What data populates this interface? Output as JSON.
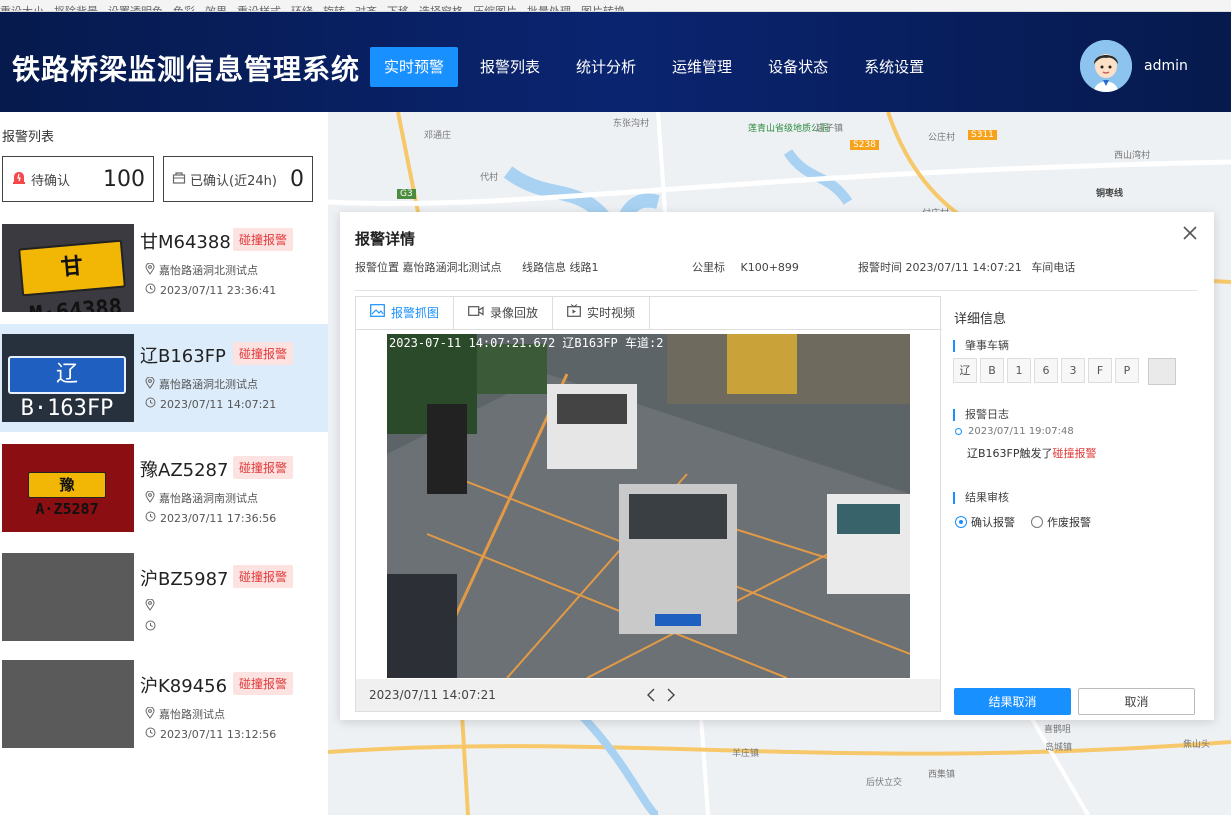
{
  "toolbar": [
    "重设大小",
    "抠除背景",
    "设置透明色",
    "色彩",
    "效果",
    "重设样式",
    "环绕",
    "旋转",
    "对齐",
    "下移",
    "选择窗格",
    "压缩图片",
    "批量处理",
    "图片转换"
  ],
  "header": {
    "title": "铁路桥梁监测信息管理系统",
    "nav": [
      "实时预警",
      "报警列表",
      "统计分析",
      "运维管理",
      "设备状态",
      "系统设置"
    ],
    "active_nav": "实时预警",
    "user": "admin"
  },
  "left_panel": {
    "title": "报警列表",
    "pending_label": "待确认",
    "pending_count": "100",
    "confirmed_label": "已确认(近24h)",
    "confirmed_count": "0",
    "alarms": [
      {
        "plate": "甘M64388",
        "tag": "碰撞报警",
        "location": "嘉怡路涵洞北测试点",
        "time": "2023/07/11 23:36:41",
        "thumb_plate": "甘M·64388",
        "thumb_color": "yellow"
      },
      {
        "plate": "辽B163FP",
        "tag": "碰撞报警",
        "location": "嘉怡路涵洞北测试点",
        "time": "2023/07/11 14:07:21",
        "thumb_plate": "辽B·163FP",
        "thumb_color": "blue"
      },
      {
        "plate": "豫AZ5287",
        "tag": "碰撞报警",
        "location": "嘉怡路涵洞南测试点",
        "time": "2023/07/11 17:36:56",
        "thumb_plate": "豫A·Z5287",
        "thumb_color": "yellow"
      },
      {
        "plate": "沪BZ5987",
        "tag": "碰撞报警",
        "location": "",
        "time": "",
        "thumb_plate": "",
        "thumb_color": "none"
      },
      {
        "plate": "沪K89456",
        "tag": "碰撞报警",
        "location": "嘉怡路测试点",
        "time": "2023/07/11 13:12:56",
        "thumb_plate": "",
        "thumb_color": "none"
      }
    ]
  },
  "map_labels": [
    "邓通庄",
    "东张沟村",
    "莲青山省级地质公园",
    "店子镇",
    "公庄村",
    "西山湾村",
    "代村",
    "铜枣线",
    "付庄村",
    "羊庄镇",
    "后伏立交",
    "西集镇",
    "岛城镇",
    "焦山头",
    "喜鹊咀",
    "S311",
    "S238",
    "G3"
  ],
  "modal": {
    "title": "报警详情",
    "location_label": "报警位置",
    "location": "嘉怡路涵洞北测试点",
    "line_label": "线路信息",
    "line": "线路1",
    "km_label": "公里标",
    "km": "K100+899",
    "time_label": "报警时间",
    "time": "2023/07/11  14:07:21",
    "phone_label": "车间电话",
    "tabs": [
      "报警抓图",
      "录像回放",
      "实时视频"
    ],
    "photo_caption": "2023-07-11 14:07:21.672 辽B163FP 车道:2",
    "video_time": "2023/07/11  14:07:21",
    "detail_title": "详细信息",
    "vehicle_label": "肇事车辆",
    "plate_chars": [
      "辽",
      "B",
      "1",
      "6",
      "3",
      "F",
      "P"
    ],
    "log_label": "报警日志",
    "log_time": "2023/07/11  19:07:48",
    "log_plate": "辽B163FP触发了",
    "log_alarm": "碰撞报警",
    "review_label": "结果审核",
    "radio_confirm": "确认报警",
    "radio_void": "作废报警",
    "btn_primary": "结果取消",
    "btn_cancel": "取消"
  },
  "colors": {
    "header_bg": "#0a2470",
    "accent": "#1890ff",
    "alarm_red": "#e23b3b",
    "alarm_tag_bg": "#fde2e2",
    "selected_row": "#dcecfb"
  }
}
